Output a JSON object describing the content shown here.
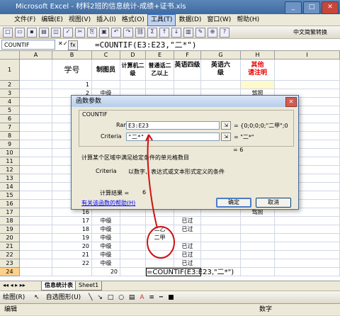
{
  "window": {
    "title": "Microsoft Excel - 材料2班的信息统计-成绩+证书.xls",
    "minimize": "_",
    "maximize": "□",
    "close": "✕"
  },
  "menu": [
    "文件(F)",
    "编辑(E)",
    "视图(V)",
    "插入(I)",
    "格式(O)",
    "工具(T)",
    "数据(D)",
    "窗口(W)",
    "帮助(H)"
  ],
  "toolbar": {
    "ime": "中文简繁转换"
  },
  "formula_bar": {
    "name_box": "COUNTIF",
    "fx": "fx",
    "formula": "=COUNTIF(E3:E23,\"二*\")"
  },
  "columns": [
    "A",
    "B",
    "C",
    "D",
    "E",
    "F",
    "G",
    "H",
    "I"
  ],
  "header_row": {
    "b": "学号",
    "c": "制图员",
    "d": "计算机二级",
    "e": "普通话二乙以上",
    "f": "英语四级",
    "g": "英语六级",
    "h_top": "其他",
    "h_bottom": "请注明"
  },
  "rows": [
    {
      "n": "1",
      "b": "",
      "c": "",
      "e": "",
      "f": "",
      "h": ""
    },
    {
      "n": "2",
      "b": "1",
      "c": "",
      "e": "",
      "f": "",
      "h": ""
    },
    {
      "n": "3",
      "b": "2",
      "c": "中级",
      "e": "",
      "f": "",
      "h": "驾照"
    },
    {
      "n": "4",
      "b": "3",
      "c": "",
      "e": "",
      "f": "",
      "h": ""
    },
    {
      "n": "5",
      "b": "4",
      "c": "",
      "e": "",
      "f": "",
      "h": ""
    },
    {
      "n": "6",
      "b": "5",
      "c": "",
      "e": "",
      "f": "",
      "h": ""
    },
    {
      "n": "7",
      "b": "6",
      "c": "",
      "e": "",
      "f": "",
      "h": ""
    },
    {
      "n": "8",
      "b": "7",
      "c": "",
      "e": "",
      "f": "",
      "h": ""
    },
    {
      "n": "9",
      "b": "8",
      "c": "",
      "e": "",
      "f": "",
      "h": ""
    },
    {
      "n": "10",
      "b": "9",
      "c": "",
      "e": "",
      "f": "",
      "h": ""
    },
    {
      "n": "11",
      "b": "10",
      "c": "",
      "e": "",
      "f": "",
      "h": ""
    },
    {
      "n": "12",
      "b": "11",
      "c": "",
      "e": "",
      "f": "",
      "h": ""
    },
    {
      "n": "13",
      "b": "12",
      "c": "",
      "e": "",
      "f": "",
      "h": ""
    },
    {
      "n": "14",
      "b": "13",
      "c": "",
      "e": "",
      "f": "",
      "h": ""
    },
    {
      "n": "15",
      "b": "14",
      "c": "",
      "e": "",
      "f": "",
      "h": ""
    },
    {
      "n": "16",
      "b": "15",
      "c": "",
      "e": "",
      "f": "",
      "h": ""
    },
    {
      "n": "17",
      "b": "16",
      "c": "",
      "e": "",
      "f": "",
      "h": "驾照"
    },
    {
      "n": "18",
      "b": "17",
      "c": "中级",
      "e": "",
      "f": "已过",
      "h": ""
    },
    {
      "n": "19",
      "b": "18",
      "c": "中级",
      "e": "二乙",
      "f": "已过",
      "h": ""
    },
    {
      "n": "20",
      "b": "19",
      "c": "中级",
      "e": "二甲",
      "f": "",
      "h": ""
    },
    {
      "n": "21",
      "b": "20",
      "c": "中级",
      "e": "",
      "f": "已过",
      "h": ""
    },
    {
      "n": "22",
      "b": "21",
      "c": "中级",
      "e": "",
      "f": "已过",
      "h": ""
    },
    {
      "n": "23",
      "b": "22",
      "c": "中级",
      "e": "",
      "f": "已过",
      "h": ""
    },
    {
      "n": "24",
      "b": "",
      "c": "20",
      "e": "=COUNTIF(E3:E23,\"二*\")",
      "f": "",
      "h": ""
    }
  ],
  "sheet_tabs": {
    "nav": "◂◂ ◂ ▸ ▸▸",
    "tabs": [
      "信息统计表",
      "Sheet1"
    ]
  },
  "draw_toolbar": {
    "draw": "绘图(R)",
    "autoshapes": "自选图形(U)"
  },
  "status": {
    "left": "编辑",
    "right": "数字"
  },
  "dialog": {
    "title": "函数参数",
    "close": "✕",
    "function": "COUNTIF",
    "range_label": "Range",
    "range_value": "E3:E23",
    "range_eval": "= {0;0;0;0;\"二甲\";0",
    "criteria_label": "Criteria",
    "criteria_value": "\"二*\"",
    "criteria_eval": "= \"二*\"",
    "result_eval": "= 6",
    "description": "计算某个区域中满足给定条件的单元格数目",
    "arg_help_label": "Criteria",
    "arg_help": "以数字、表达式或文本形式定义的条件",
    "result_label": "计算结果 =",
    "result_value": "6",
    "help_link": "有关该函数的帮助(H)",
    "ok": "确定",
    "cancel": "取消"
  }
}
